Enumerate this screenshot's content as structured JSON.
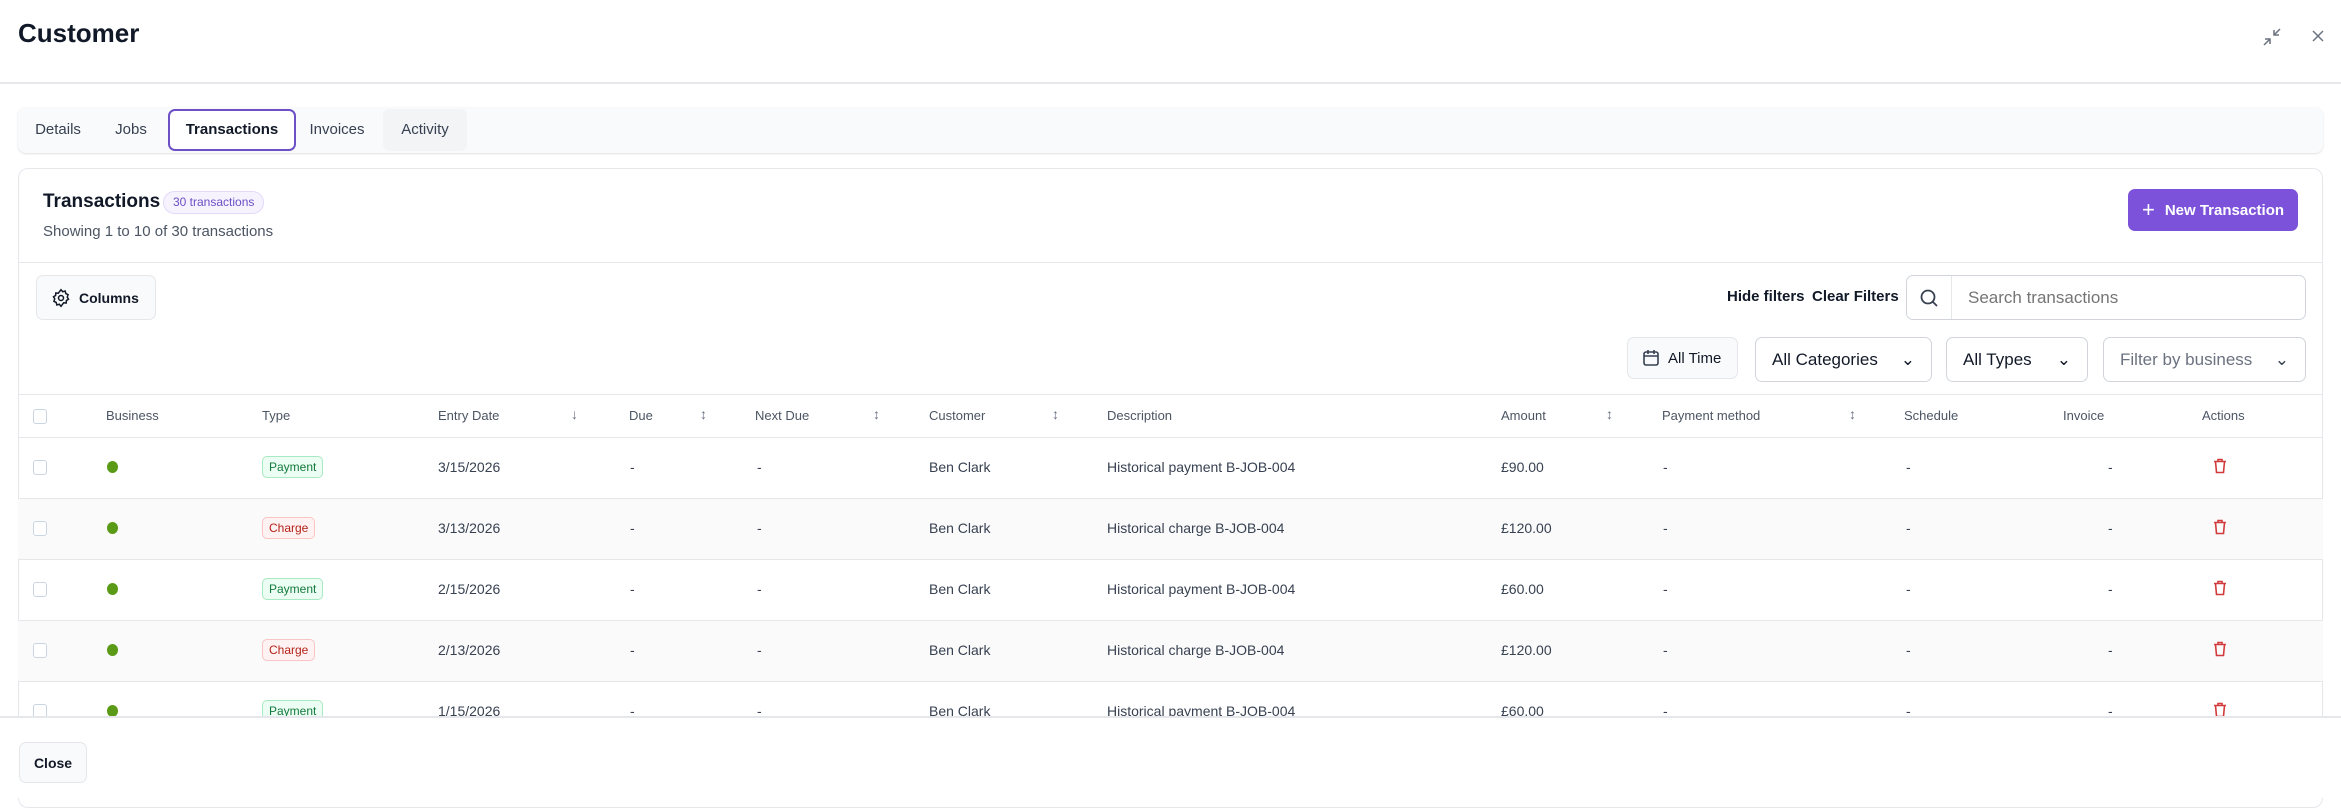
{
  "header": {
    "title": "Customer"
  },
  "tabs": [
    {
      "label": "Details"
    },
    {
      "label": "Jobs"
    },
    {
      "label": "Transactions",
      "active": true
    },
    {
      "label": "Invoices"
    },
    {
      "label": "Activity"
    }
  ],
  "card": {
    "title": "Transactions",
    "count_badge": "30 transactions",
    "subtitle": "Showing 1 to 10 of 30 transactions",
    "new_button": "New Transaction"
  },
  "toolbar": {
    "columns": "Columns",
    "hide_filters": "Hide filters",
    "clear_filters": "Clear Filters",
    "search_placeholder": "Search transactions",
    "date_filter": "All Time",
    "category_filter": "All Categories",
    "type_filter": "All Types",
    "business_filter_placeholder": "Filter by business"
  },
  "columns": [
    "Business",
    "Type",
    "Entry Date",
    "Due",
    "Next Due",
    "Customer",
    "Description",
    "Amount",
    "Payment method",
    "Schedule",
    "Invoice",
    "Actions"
  ],
  "status_color": "#5b9a16",
  "rows": [
    {
      "type": "Payment",
      "entry_date": "3/15/2026",
      "due": "-",
      "next_due": "-",
      "customer": "Ben Clark",
      "description": "Historical payment B-JOB-004",
      "amount": "£90.00",
      "payment_method": "-",
      "schedule": "-",
      "invoice": "-"
    },
    {
      "type": "Charge",
      "entry_date": "3/13/2026",
      "due": "-",
      "next_due": "-",
      "customer": "Ben Clark",
      "description": "Historical charge B-JOB-004",
      "amount": "£120.00",
      "payment_method": "-",
      "schedule": "-",
      "invoice": "-"
    },
    {
      "type": "Payment",
      "entry_date": "2/15/2026",
      "due": "-",
      "next_due": "-",
      "customer": "Ben Clark",
      "description": "Historical payment B-JOB-004",
      "amount": "£60.00",
      "payment_method": "-",
      "schedule": "-",
      "invoice": "-"
    },
    {
      "type": "Charge",
      "entry_date": "2/13/2026",
      "due": "-",
      "next_due": "-",
      "customer": "Ben Clark",
      "description": "Historical charge B-JOB-004",
      "amount": "£120.00",
      "payment_method": "-",
      "schedule": "-",
      "invoice": "-"
    },
    {
      "type": "Payment",
      "entry_date": "1/15/2026",
      "due": "-",
      "next_due": "-",
      "customer": "Ben Clark",
      "description": "Historical payment B-JOB-004",
      "amount": "£60.00",
      "payment_method": "-",
      "schedule": "-",
      "invoice": "-"
    }
  ],
  "footer": {
    "close": "Close"
  }
}
